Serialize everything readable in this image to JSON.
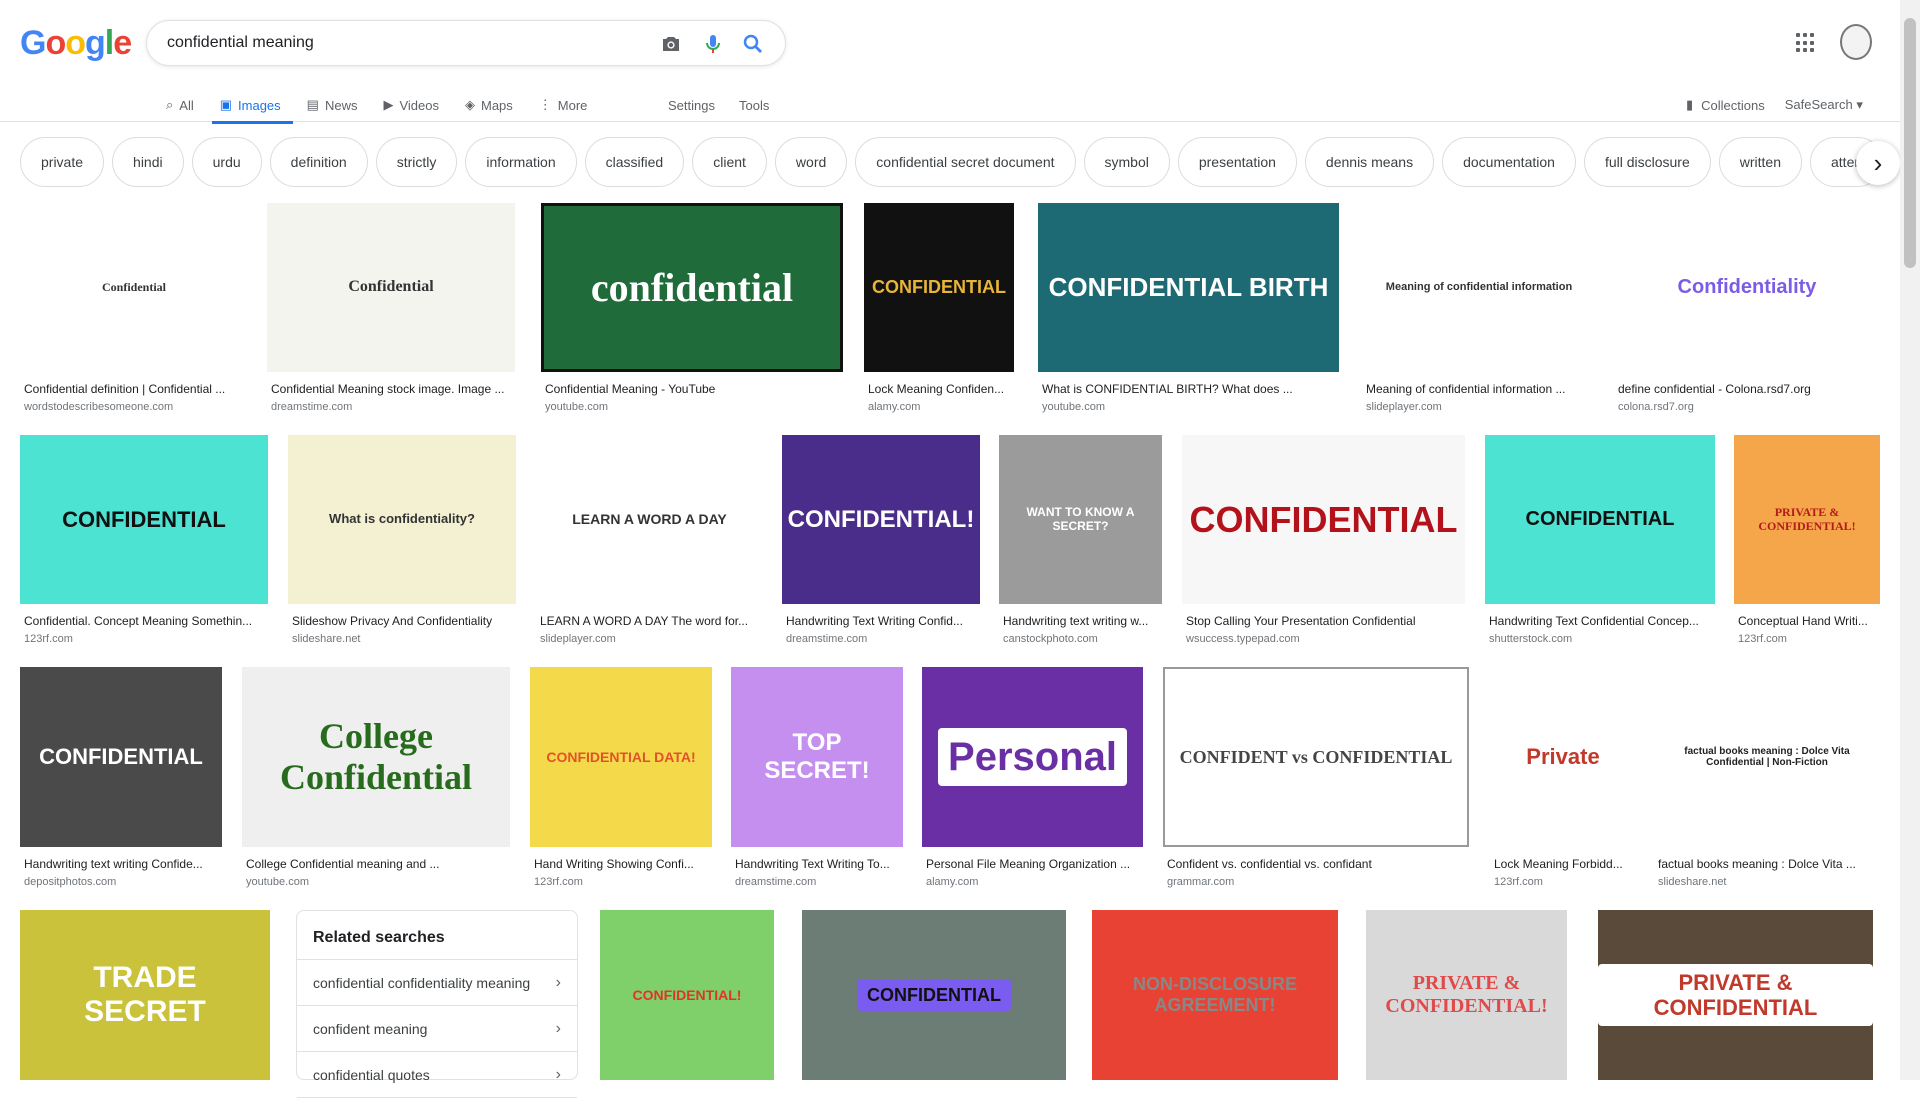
{
  "logo": [
    "G",
    "o",
    "o",
    "g",
    "l",
    "e"
  ],
  "colors": {
    "blue": "#4285f4",
    "red": "#ea4335",
    "yellow": "#fbbc05",
    "green": "#34a853",
    "accent": "#1a73e8"
  },
  "search": {
    "query": "confidential meaning"
  },
  "nav": {
    "tabs": [
      {
        "label": "All",
        "icon": "search-icon"
      },
      {
        "label": "Images",
        "icon": "image-icon",
        "active": true
      },
      {
        "label": "News",
        "icon": "news-icon"
      },
      {
        "label": "Videos",
        "icon": "video-icon"
      },
      {
        "label": "Maps",
        "icon": "map-icon"
      },
      {
        "label": "More",
        "icon": "more-vert-icon"
      }
    ],
    "settings": "Settings",
    "tools": "Tools",
    "collections": "Collections",
    "safesearch": "SafeSearch"
  },
  "chips": [
    "private",
    "hindi",
    "urdu",
    "definition",
    "strictly",
    "information",
    "classified",
    "client",
    "word",
    "confidential secret document",
    "symbol",
    "presentation",
    "dennis means",
    "documentation",
    "full disclosure",
    "written",
    "atten"
  ],
  "rows": [
    [
      {
        "title": "Confidential definition | Confidential ...",
        "source": "wordstodescribesomeone.com",
        "thumb": "Confidential"
      },
      {
        "title": "Confidential Meaning stock image. Image ...",
        "source": "dreamstime.com",
        "thumb": "Confidential"
      },
      {
        "title": "Confidential Meaning - YouTube",
        "source": "youtube.com",
        "thumb": "confidential"
      },
      {
        "title": "Lock Meaning Confiden...",
        "source": "alamy.com",
        "thumb": "CONFIDENTIAL"
      },
      {
        "title": "What is CONFIDENTIAL BIRTH? What does ...",
        "source": "youtube.com",
        "thumb": "CONFIDENTIAL BIRTH"
      },
      {
        "title": "Meaning of confidential information ...",
        "source": "slideplayer.com",
        "thumb": "Meaning of confidential information"
      },
      {
        "title": "define confidential - Colona.rsd7.org",
        "source": "colona.rsd7.org",
        "thumb": "Confidentiality"
      }
    ],
    [
      {
        "title": "Confidential. Concept Meaning Somethin...",
        "source": "123rf.com",
        "thumb": "CONFIDENTIAL"
      },
      {
        "title": "Slideshow Privacy And Confidentiality",
        "source": "slideshare.net",
        "thumb": "What is confidentiality?"
      },
      {
        "title": "LEARN A WORD A DAY The word for...",
        "source": "slideplayer.com",
        "thumb": "LEARN A WORD A DAY"
      },
      {
        "title": "Handwriting Text Writing Confid...",
        "source": "dreamstime.com",
        "thumb": "CONFIDENTIAL!"
      },
      {
        "title": "Handwriting text writing w...",
        "source": "canstockphoto.com",
        "thumb": "WANT TO KNOW A SECRET?"
      },
      {
        "title": "Stop Calling Your Presentation Confidential",
        "source": "wsuccess.typepad.com",
        "thumb": "CONFIDENTIAL"
      },
      {
        "title": "Handwriting Text Confidential Concep...",
        "source": "shutterstock.com",
        "thumb": "CONFIDENTIAL"
      },
      {
        "title": "Conceptual Hand Writi...",
        "source": "123rf.com",
        "thumb": "PRIVATE & CONFIDENTIAL!"
      }
    ],
    [
      {
        "title": "Handwriting text writing Confide...",
        "source": "depositphotos.com",
        "thumb": "CONFIDENTIAL"
      },
      {
        "title": "College Confidential meaning and ...",
        "source": "youtube.com",
        "thumb": "College Confidential"
      },
      {
        "title": "Hand Writing Showing Confi...",
        "source": "123rf.com",
        "thumb": "CONFIDENTIAL DATA!"
      },
      {
        "title": "Handwriting Text Writing To...",
        "source": "dreamstime.com",
        "thumb": "TOP SECRET!"
      },
      {
        "title": "Personal File Meaning Organization ...",
        "source": "alamy.com",
        "thumb": "Personal"
      },
      {
        "title": "Confident vs. confidential vs. confidant",
        "source": "grammar.com",
        "thumb": "CONFIDENT vs CONFIDENTIAL"
      },
      {
        "title": "Lock Meaning Forbidd...",
        "source": "123rf.com",
        "thumb": "Private"
      },
      {
        "title": "factual books meaning : Dolce Vita ...",
        "source": "slideshare.net",
        "thumb": "factual books meaning : Dolce Vita Confidential | Non-Fiction"
      }
    ],
    [
      {
        "thumb": "TRADE SECRET"
      },
      {
        "thumb": "CONFIDENTIAL!"
      },
      {
        "thumb": "CONFIDENTIAL"
      },
      {
        "thumb": "NON-DISCLOSURE AGREEMENT!"
      },
      {
        "thumb": "PRIVATE & CONFIDENTIAL!"
      },
      {
        "thumb": "PRIVATE & CONFIDENTIAL"
      }
    ]
  ],
  "related": {
    "heading": "Related searches",
    "items": [
      "confidential confidentiality meaning",
      "confident meaning",
      "confidential quotes"
    ]
  }
}
